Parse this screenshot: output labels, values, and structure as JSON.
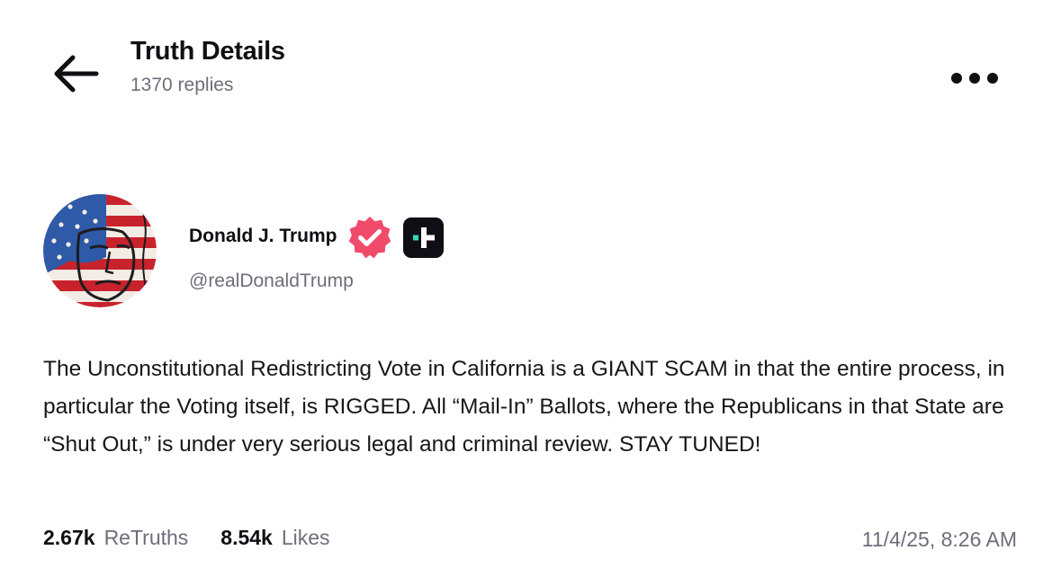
{
  "header": {
    "title": "Truth Details",
    "subtitle": "1370 replies",
    "back_icon": "arrow-left-icon",
    "more_icon": "more-horizontal-icon"
  },
  "post": {
    "author": {
      "display_name": "Donald J. Trump",
      "handle": "@realDonaldTrump",
      "verified_icon": "verified-badge-icon",
      "plus_icon": "plus-badge-icon"
    },
    "body": "The Unconstitutional Redistricting Vote in California is a GIANT SCAM in that the entire process, in particular the Voting itself, is RIGGED. All “Mail-In” Ballots, where the Republicans in that State are “Shut Out,” is under very serious legal and criminal review. STAY TUNED!",
    "stats": {
      "retruths_count": "2.67k",
      "retruths_label": "ReTruths",
      "likes_count": "8.54k",
      "likes_label": "Likes"
    },
    "timestamp": "11/4/25, 8:26 AM"
  },
  "colors": {
    "text_primary": "#0f0f14",
    "text_secondary": "#6e6e7a",
    "verified_pink": "#f04b6a",
    "plus_dark": "#0e0e14",
    "plus_teal": "#35d6b4"
  }
}
